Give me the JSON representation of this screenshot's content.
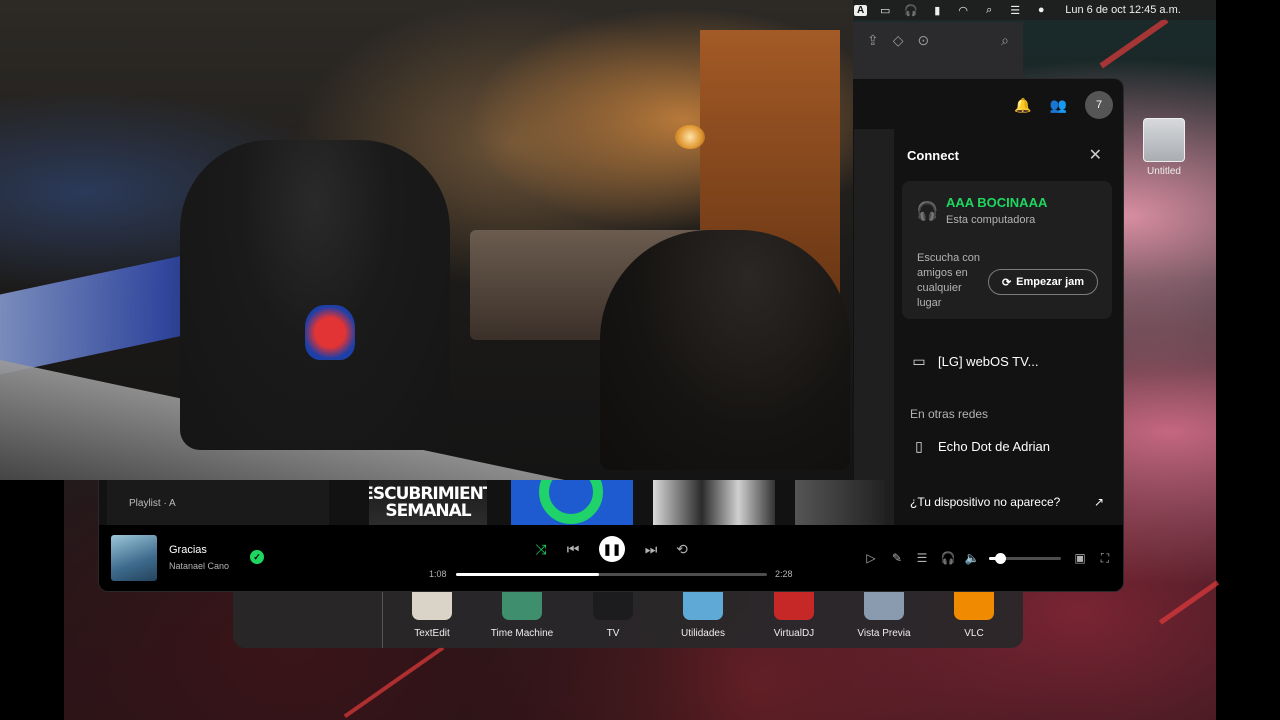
{
  "menubar": {
    "input_source": "A",
    "datetime": "Lun 6 de oct  12:45 a.m."
  },
  "desktop": {
    "drive_label": "Untitled"
  },
  "spotify": {
    "avatar_initial": "7",
    "connect": {
      "title": "Connect",
      "current_device": {
        "name": "AAA BOCINAAA",
        "subtitle": "Esta computadora"
      },
      "jam_text": "Escucha con amigos en cualquier lugar",
      "jam_button": "Empezar jam",
      "devices": [
        {
          "name": "[LG] webOS TV...",
          "icon": "tv-icon"
        }
      ],
      "other_networks_label": "En otras redes",
      "other_devices": [
        {
          "name": "Echo Dot de Adrian",
          "icon": "speaker-icon"
        }
      ],
      "not_appearing_link": "¿Tu dispositivo no aparece?"
    },
    "carousel": {
      "card0_text": "Playlist · A",
      "card1_text": "DESCUBRIMIENTO SEMANAL"
    },
    "now_playing": {
      "title": "Gracias",
      "artist": "Natanael Cano",
      "time_elapsed": "1:08",
      "time_total": "2:28",
      "progress": 0.46,
      "volume": 0.16,
      "accent": "#1ed760"
    }
  },
  "dock": {
    "items": [
      {
        "label": "TextEdit",
        "color": "#d9d4c7"
      },
      {
        "label": "Time Machine",
        "color": "#3f8f6e"
      },
      {
        "label": "TV",
        "color": "#1c1c1e"
      },
      {
        "label": "Utilidades",
        "color": "#5fa9d6"
      },
      {
        "label": "VirtualDJ",
        "color": "#c62828"
      },
      {
        "label": "Vista Previa",
        "color": "#8a9bb0"
      },
      {
        "label": "VLC",
        "color": "#f08a00"
      }
    ]
  }
}
